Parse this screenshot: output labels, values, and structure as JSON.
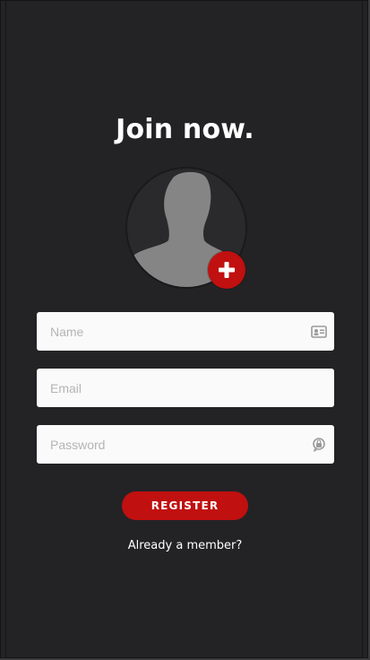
{
  "title": "Join now.",
  "avatar": {
    "icon": "user-silhouette-icon",
    "add_icon": "plus-icon"
  },
  "form": {
    "name": {
      "placeholder": "Name",
      "icon": "id-card-icon"
    },
    "email": {
      "placeholder": "Email"
    },
    "password": {
      "placeholder": "Password",
      "icon": "lock-icon"
    }
  },
  "register_label": "REGISTER",
  "member_link": "Already a member?",
  "colors": {
    "background": "#232326",
    "accent": "#c0100f",
    "field": "#fafafa",
    "text": "#ffffff"
  }
}
